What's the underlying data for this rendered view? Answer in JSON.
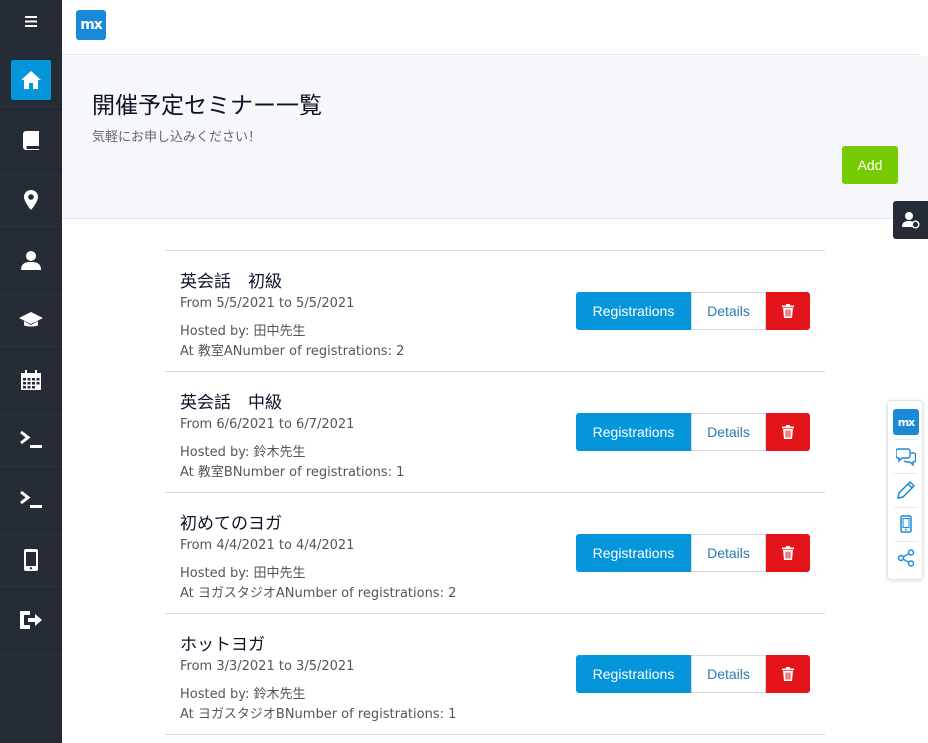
{
  "brand": {
    "logo_text": "mx"
  },
  "sidebar": {
    "items": [
      {
        "icon": "home-icon",
        "active": true
      },
      {
        "icon": "book-icon"
      },
      {
        "icon": "map-pin-icon"
      },
      {
        "icon": "user-icon"
      },
      {
        "icon": "graduation-cap-icon"
      },
      {
        "icon": "calendar-icon"
      },
      {
        "icon": "terminal-icon"
      },
      {
        "icon": "terminal-icon"
      },
      {
        "icon": "mobile-icon"
      },
      {
        "icon": "logout-icon"
      }
    ]
  },
  "hero": {
    "title": "開催予定セミナー一覧",
    "subtitle": "気軽にお申し込みください！",
    "add_label": "Add"
  },
  "seminars": [
    {
      "title": "英会話　初級",
      "dates": "From 5/5/2021 to 5/5/2021",
      "host": "Hosted by: 田中先生",
      "location": "At 教室ANumber of registrations: 2"
    },
    {
      "title": "英会話　中級",
      "dates": "From 6/6/2021 to 6/7/2021",
      "host": "Hosted by: 鈴木先生",
      "location": "At 教室BNumber of registrations: 1"
    },
    {
      "title": "初めてのヨガ",
      "dates": "From 4/4/2021 to 4/4/2021",
      "host": "Hosted by: 田中先生",
      "location": "At ヨガスタジオANumber of registrations: 2"
    },
    {
      "title": "ホットヨガ",
      "dates": "From 3/3/2021 to 3/5/2021",
      "host": "Hosted by: 鈴木先生",
      "location": "At ヨガスタジオBNumber of registrations: 1"
    }
  ],
  "actions": {
    "registrations_label": "Registrations",
    "details_label": "Details"
  },
  "toolbox": {
    "logo_text": "mx"
  },
  "colors": {
    "sidebar": "#252c36",
    "primary": "#0595db",
    "success": "#76ca02",
    "danger": "#e3151b"
  }
}
